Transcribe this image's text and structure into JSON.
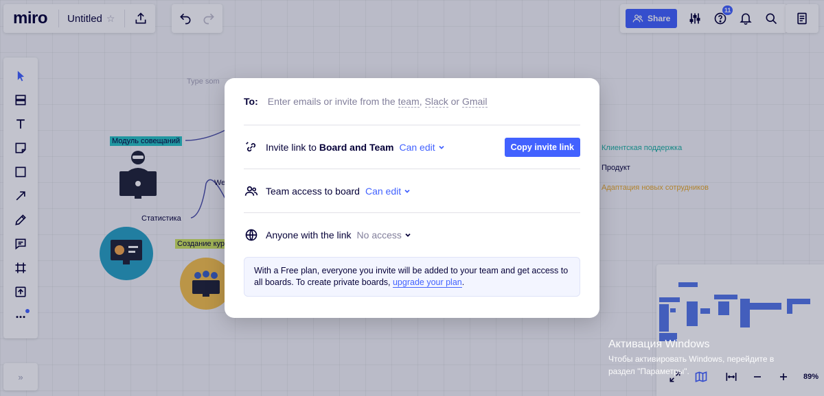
{
  "app": {
    "logo": "miro",
    "board_title": "Untitled"
  },
  "topbar": {
    "share_label": "Share",
    "notification_count": "11"
  },
  "board": {
    "type_placeholder": "Type som",
    "nodes": {
      "meetings_module": "Модуль совещаний",
      "statistics": "Статистика",
      "course_creation": "Создание кур",
      "we_fragment": "We",
      "client_support": "Клиентская поддержка",
      "product": "Продукт",
      "onboarding": "Адаптация новых сотрудников"
    }
  },
  "dialog": {
    "to_label": "To:",
    "to_placeholder_prefix": "Enter emails or invite from the ",
    "to_team": "team",
    "to_comma": ",",
    "to_slack": "Slack",
    "to_or": " or ",
    "to_gmail": "Gmail",
    "invite_link_prefix": "Invite link to ",
    "invite_link_target": "Board and Team",
    "invite_link_permission": "Can edit",
    "copy_link_label": "Copy invite link",
    "team_access_label": "Team access to board",
    "team_access_permission": "Can edit",
    "anyone_label": "Anyone with the link",
    "anyone_permission": "No access",
    "info_text": "With a Free plan, everyone you invite will be added to your team and get access to all boards. To create private boards, ",
    "info_link": "upgrade your plan",
    "info_suffix": "."
  },
  "zoom": {
    "level": "89%"
  },
  "watermark": {
    "title": "Активация Windows",
    "line1": "Чтобы активировать Windows, перейдите в",
    "line2": "раздел \"Параметры\"."
  },
  "colors": {
    "accent": "#4262ff",
    "teal_tag": "#27c4c4",
    "yellow_tag": "#cfe65e"
  }
}
